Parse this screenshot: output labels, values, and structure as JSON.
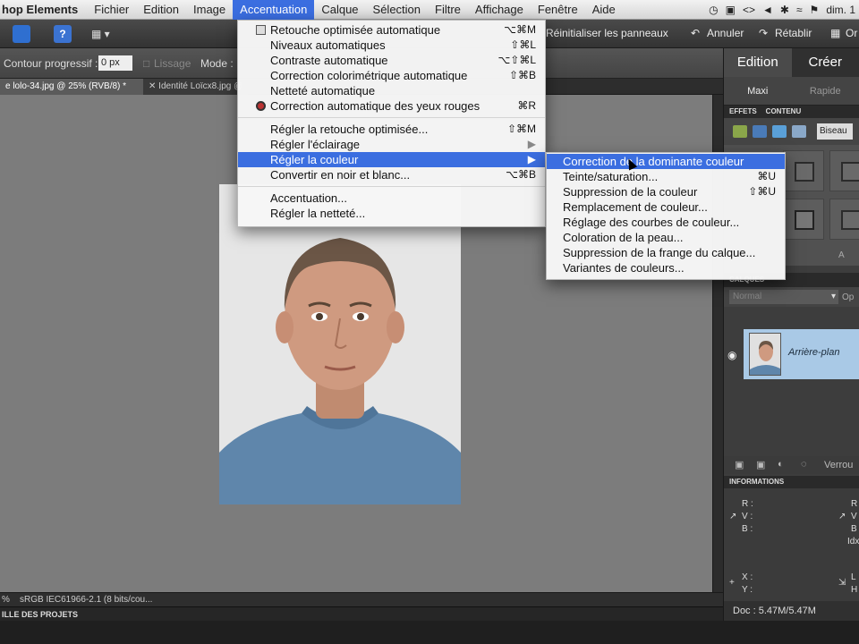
{
  "menubar": {
    "app_name": "hop Elements",
    "items": [
      "Fichier",
      "Edition",
      "Image",
      "Accentuation",
      "Calque",
      "Sélection",
      "Filtre",
      "Affichage",
      "Fenêtre",
      "Aide"
    ],
    "active_index": 3,
    "clock": "dim. 1",
    "icons": [
      "clock-icon",
      "display-icon",
      "code-icon",
      "volume-icon",
      "bluetooth-icon",
      "battery-icon",
      "wifi-icon",
      "flag-icon"
    ]
  },
  "appbar": {
    "reset_panels": "Réinitialiser les panneaux",
    "undo": "Annuler",
    "redo": "Rétablir",
    "organiser": "Or"
  },
  "options": {
    "feather_label": "Contour progressif :",
    "feather_value": "0 px",
    "smoothing_label": "Lissage",
    "mode_label": "Mode :"
  },
  "tabs": [
    "e lolo-34.jpg @ 25% (RVB/8) *",
    "Identité Loïcx8.jpg @"
  ],
  "statusbar": {
    "zoom": "%",
    "profile": "sRGB IEC61966-2.1 (8 bits/cou..."
  },
  "projectbin": {
    "label": "ILLE DES PROJETS"
  },
  "rightpanel": {
    "modes": [
      "Edition",
      "Créer"
    ],
    "submodes": [
      "Maxi",
      "Rapide"
    ],
    "effects_tabs": [
      "EFFETS",
      "CONTENU"
    ],
    "effects_dropdown": "Biseau",
    "more_button": "A",
    "layers_title": "CALQUES",
    "blend_mode": "Normal",
    "opacity_label": "Op",
    "layer_name": "Arrière-plan",
    "lock_label": "Verrou",
    "info_title": "INFORMATIONS",
    "info_labels": [
      "R :",
      "V :",
      "B :"
    ],
    "info_right": [
      "R",
      "V",
      "B",
      "Idx"
    ],
    "xy_labels": [
      "X :",
      "Y :"
    ],
    "lh_labels": [
      "L",
      "H"
    ],
    "doc_size": "Doc : 5.47M/5.47M"
  },
  "menu_accentuation": {
    "items": [
      {
        "label": "Retouche optimisée automatique",
        "shortcut": "⌥⌘M",
        "icon": "auto-smart-fix-icon"
      },
      {
        "label": "Niveaux automatiques",
        "shortcut": "⇧⌘L"
      },
      {
        "label": "Contraste automatique",
        "shortcut": "⌥⇧⌘L"
      },
      {
        "label": "Correction colorimétrique automatique",
        "shortcut": "⇧⌘B"
      },
      {
        "label": "Netteté automatique",
        "shortcut": ""
      },
      {
        "label": "Correction automatique des yeux rouges",
        "shortcut": "⌘R",
        "icon": "red-eye-icon"
      },
      {
        "sep": true
      },
      {
        "label": "Régler la retouche optimisée...",
        "shortcut": "⇧⌘M"
      },
      {
        "label": "Régler l'éclairage",
        "shortcut": "▶"
      },
      {
        "label": "Régler la couleur",
        "shortcut": "▶",
        "highlighted": true
      },
      {
        "label": "Convertir en noir et blanc...",
        "shortcut": "⌥⌘B"
      },
      {
        "sep": true
      },
      {
        "label": "Accentuation...",
        "shortcut": ""
      },
      {
        "label": "Régler la netteté...",
        "shortcut": ""
      }
    ]
  },
  "menu_couleur": {
    "items": [
      {
        "label": "Correction de la dominante couleur",
        "shortcut": "",
        "highlighted": true
      },
      {
        "label": "Teinte/saturation...",
        "shortcut": "⌘U"
      },
      {
        "label": "Suppression de la couleur",
        "shortcut": "⇧⌘U"
      },
      {
        "label": "Remplacement de couleur...",
        "shortcut": ""
      },
      {
        "label": "Réglage des courbes de couleur...",
        "shortcut": ""
      },
      {
        "label": "Coloration de la peau...",
        "shortcut": ""
      },
      {
        "label": "Suppression de la frange du calque...",
        "shortcut": ""
      },
      {
        "label": "Variantes de couleurs...",
        "shortcut": ""
      }
    ]
  },
  "colors": {
    "accent": "#3b6ee0",
    "canvas": "#7c7c7c",
    "shirt": "#5f86ab"
  }
}
